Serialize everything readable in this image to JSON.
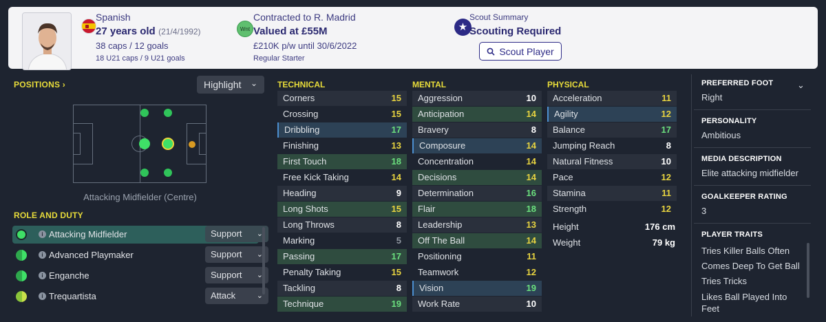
{
  "header": {
    "nationality": "Spanish",
    "age": "27 years old",
    "dob": "(21/4/1992)",
    "caps": "38 caps / 12 goals",
    "u21_caps": "18 U21 caps / 9 U21 goals",
    "contract_label": "Contracted to R. Madrid",
    "value": "Valued at £55M",
    "wage": "£210K p/w until 30/6/2022",
    "squad_status": "Regular Starter",
    "wnt_badge": "Wnt",
    "scout_summary_label": "Scout Summary",
    "scout_summary_value": "Scouting Required",
    "scout_button": "Scout Player"
  },
  "positions": {
    "title": "POSITIONS",
    "highlight_label": "Highlight",
    "caption": "Attacking Midfielder (Centre)"
  },
  "roles": {
    "title": "ROLE AND DUTY",
    "items": [
      {
        "name": "Attacking Midfielder",
        "duty": "Support",
        "active": true
      },
      {
        "name": "Advanced Playmaker",
        "duty": "Support",
        "active": false
      },
      {
        "name": "Enganche",
        "duty": "Support",
        "active": false
      },
      {
        "name": "Trequartista",
        "duty": "Attack",
        "active": false
      }
    ]
  },
  "technical": {
    "title": "TECHNICAL",
    "attrs": [
      {
        "name": "Corners",
        "value": "15",
        "style": "dark",
        "color": "yellow"
      },
      {
        "name": "Crossing",
        "value": "15",
        "style": "",
        "color": "yellow"
      },
      {
        "name": "Dribbling",
        "value": "17",
        "style": "hl-blue",
        "color": "green"
      },
      {
        "name": "Finishing",
        "value": "13",
        "style": "",
        "color": "yellow"
      },
      {
        "name": "First Touch",
        "value": "18",
        "style": "hl-green",
        "color": "green"
      },
      {
        "name": "Free Kick Taking",
        "value": "14",
        "style": "",
        "color": "yellow"
      },
      {
        "name": "Heading",
        "value": "9",
        "style": "dark",
        "color": "white"
      },
      {
        "name": "Long Shots",
        "value": "15",
        "style": "hl-green",
        "color": "yellow"
      },
      {
        "name": "Long Throws",
        "value": "8",
        "style": "dark",
        "color": "white"
      },
      {
        "name": "Marking",
        "value": "5",
        "style": "",
        "color": "grey"
      },
      {
        "name": "Passing",
        "value": "17",
        "style": "hl-green",
        "color": "green"
      },
      {
        "name": "Penalty Taking",
        "value": "15",
        "style": "",
        "color": "yellow"
      },
      {
        "name": "Tackling",
        "value": "8",
        "style": "dark",
        "color": "white"
      },
      {
        "name": "Technique",
        "value": "19",
        "style": "hl-green",
        "color": "green"
      }
    ]
  },
  "mental": {
    "title": "MENTAL",
    "attrs": [
      {
        "name": "Aggression",
        "value": "10",
        "style": "dark",
        "color": "white"
      },
      {
        "name": "Anticipation",
        "value": "14",
        "style": "hl-green",
        "color": "yellow"
      },
      {
        "name": "Bravery",
        "value": "8",
        "style": "dark",
        "color": "white"
      },
      {
        "name": "Composure",
        "value": "14",
        "style": "hl-blue",
        "color": "yellow"
      },
      {
        "name": "Concentration",
        "value": "14",
        "style": "",
        "color": "yellow"
      },
      {
        "name": "Decisions",
        "value": "14",
        "style": "hl-green",
        "color": "yellow"
      },
      {
        "name": "Determination",
        "value": "16",
        "style": "dark",
        "color": "green"
      },
      {
        "name": "Flair",
        "value": "18",
        "style": "hl-green",
        "color": "green"
      },
      {
        "name": "Leadership",
        "value": "13",
        "style": "dark",
        "color": "yellow"
      },
      {
        "name": "Off The Ball",
        "value": "14",
        "style": "hl-green",
        "color": "yellow"
      },
      {
        "name": "Positioning",
        "value": "11",
        "style": "",
        "color": "yellow"
      },
      {
        "name": "Teamwork",
        "value": "12",
        "style": "",
        "color": "yellow"
      },
      {
        "name": "Vision",
        "value": "19",
        "style": "hl-blue",
        "color": "green"
      },
      {
        "name": "Work Rate",
        "value": "10",
        "style": "dark",
        "color": "white"
      }
    ]
  },
  "physical": {
    "title": "PHYSICAL",
    "attrs": [
      {
        "name": "Acceleration",
        "value": "11",
        "style": "dark",
        "color": "yellow"
      },
      {
        "name": "Agility",
        "value": "12",
        "style": "hl-blue",
        "color": "yellow"
      },
      {
        "name": "Balance",
        "value": "17",
        "style": "dark",
        "color": "green"
      },
      {
        "name": "Jumping Reach",
        "value": "8",
        "style": "",
        "color": "white"
      },
      {
        "name": "Natural Fitness",
        "value": "10",
        "style": "dark",
        "color": "white"
      },
      {
        "name": "Pace",
        "value": "12",
        "style": "",
        "color": "yellow"
      },
      {
        "name": "Stamina",
        "value": "11",
        "style": "dark",
        "color": "yellow"
      },
      {
        "name": "Strength",
        "value": "12",
        "style": "",
        "color": "yellow"
      }
    ],
    "height_label": "Height",
    "height_value": "176 cm",
    "weight_label": "Weight",
    "weight_value": "79 kg"
  },
  "profile": {
    "preferred_foot_label": "PREFERRED FOOT",
    "preferred_foot": "Right",
    "personality_label": "PERSONALITY",
    "personality": "Ambitious",
    "media_label": "MEDIA DESCRIPTION",
    "media": "Elite attacking midfielder",
    "gk_label": "GOALKEEPER RATING",
    "gk_rating": "3",
    "traits_label": "PLAYER TRAITS",
    "traits": [
      "Tries Killer Balls Often",
      "Comes Deep To Get Ball",
      "Tries Tricks",
      "Likes Ball Played Into Feet"
    ]
  },
  "colors": {
    "accent_yellow": "#e8dc3a",
    "value_green": "#6be07e",
    "value_yellow": "#e8d440",
    "active_role": "#2d5f5b",
    "brand_navy": "#2c2a86"
  }
}
